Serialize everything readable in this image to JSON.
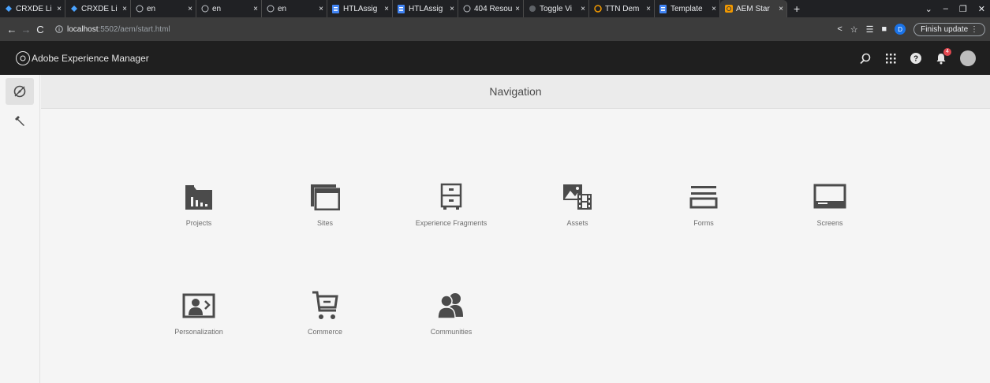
{
  "browser": {
    "tabs": [
      {
        "label": "CRXDE Li",
        "icon": "crxde-icon"
      },
      {
        "label": "CRXDE Li",
        "icon": "crxde-icon"
      },
      {
        "label": "en",
        "icon": "globe-icon"
      },
      {
        "label": "en",
        "icon": "globe-icon"
      },
      {
        "label": "en",
        "icon": "globe-icon"
      },
      {
        "label": "HTLAssig",
        "icon": "docs-icon"
      },
      {
        "label": "HTLAssig",
        "icon": "docs-icon"
      },
      {
        "label": "404 Resou",
        "icon": "globe-icon"
      },
      {
        "label": "Toggle Vi",
        "icon": "toggle-icon"
      },
      {
        "label": "TTN Dem",
        "icon": "aem-icon"
      },
      {
        "label": "Template",
        "icon": "docs-icon"
      },
      {
        "label": "AEM Star",
        "icon": "aem-icon"
      }
    ],
    "new_tab": "+",
    "close_glyph": "×",
    "url_host": "localhost",
    "url_path": ":5502/aem/start.html",
    "profile_initial": "D",
    "finish_update": "Finish update"
  },
  "aem": {
    "title": "Adobe Experience Manager",
    "notification_count": "4",
    "page_title": "Navigation",
    "tiles": [
      {
        "label": "Projects",
        "icon": "projects-icon"
      },
      {
        "label": "Sites",
        "icon": "sites-icon"
      },
      {
        "label": "Experience Fragments",
        "icon": "experience-fragments-icon"
      },
      {
        "label": "Assets",
        "icon": "assets-icon"
      },
      {
        "label": "Forms",
        "icon": "forms-icon"
      },
      {
        "label": "Screens",
        "icon": "screens-icon"
      },
      {
        "label": "Personalization",
        "icon": "personalization-icon"
      },
      {
        "label": "Commerce",
        "icon": "commerce-icon"
      },
      {
        "label": "Communities",
        "icon": "communities-icon"
      }
    ]
  },
  "colors": {
    "header_bg": "#1f1f1f",
    "icon_gray": "#4b4b4b",
    "badge": "#e34850",
    "browser_bg": "#202124"
  }
}
